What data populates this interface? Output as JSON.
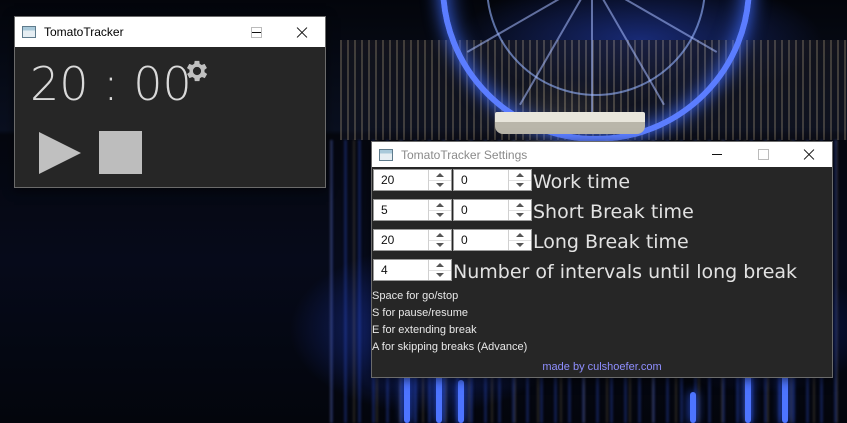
{
  "timer_window": {
    "title": "TomatoTracker",
    "time_display": "20 : 00",
    "icons": {
      "settings": "gear-icon",
      "play": "play-icon",
      "stop": "stop-icon"
    }
  },
  "settings_window": {
    "title": "TomatoTracker Settings",
    "rows": [
      {
        "label": "Work time",
        "minutes": "20",
        "seconds": "0"
      },
      {
        "label": "Short Break time",
        "minutes": "5",
        "seconds": "0"
      },
      {
        "label": "Long Break time",
        "minutes": "20",
        "seconds": "0"
      },
      {
        "label": "Number of intervals until long break",
        "count": "4"
      }
    ],
    "hints": [
      "Space for go/stop",
      "S for pause/resume",
      "E for extending break",
      "A for skipping breaks (Advance)"
    ],
    "credit": "made by culshoefer.com"
  },
  "colors": {
    "window_bg": "#262626",
    "text": "#e2e2e2",
    "credit_link": "#8f8fff",
    "control_gray": "#bdbdbd"
  }
}
